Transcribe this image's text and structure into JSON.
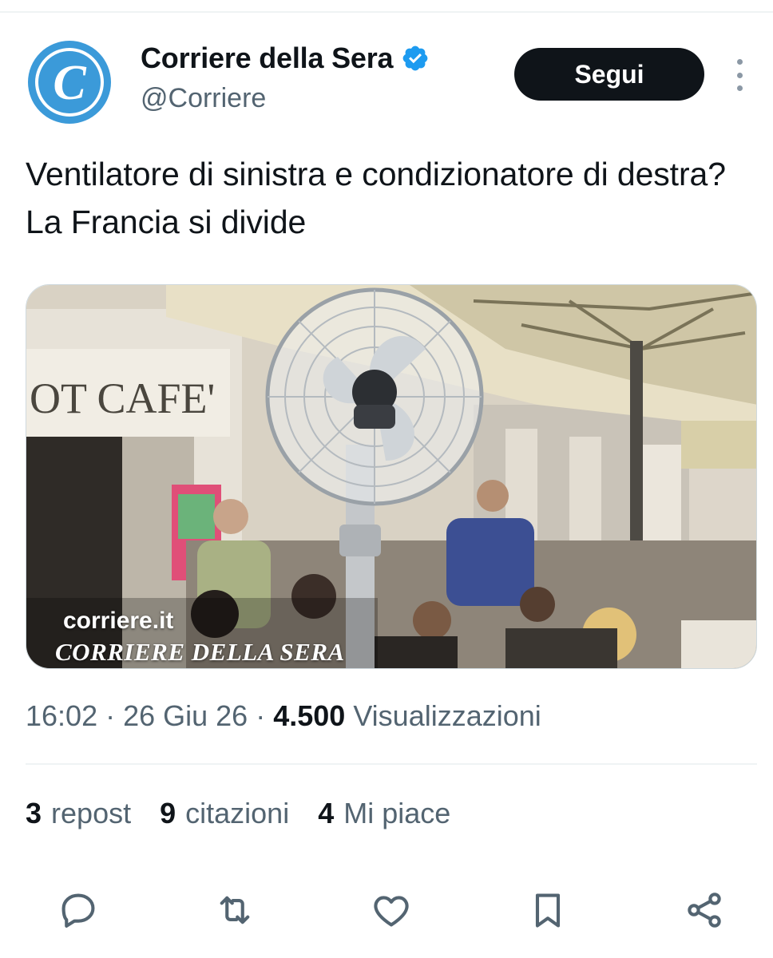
{
  "account": {
    "display_name": "Corriere della Sera",
    "handle": "@Corriere",
    "verified": true,
    "avatar_letter": "C",
    "avatar_color": "#3b9ad9"
  },
  "follow_button": {
    "label": "Segui"
  },
  "tweet": {
    "text": "Ventilatore di sinistra e condizionatore di destra? La Francia si divide"
  },
  "media": {
    "source": "corriere.it",
    "watermark": "CORRIERE DELLA SERA",
    "sign_text": "OT CAFE'"
  },
  "meta": {
    "time": "16:02",
    "separator": "·",
    "date": "26 Giu 26",
    "views_count": "4.500",
    "views_label": "Visualizzazioni"
  },
  "stats": {
    "reposts": {
      "count": "3",
      "label": "repost"
    },
    "quotes": {
      "count": "9",
      "label": "citazioni"
    },
    "likes": {
      "count": "4",
      "label": "Mi piace"
    }
  },
  "actions": [
    {
      "icon": "reply-icon"
    },
    {
      "icon": "repost-icon"
    },
    {
      "icon": "like-icon"
    },
    {
      "icon": "bookmark-icon"
    },
    {
      "icon": "share-icon"
    }
  ],
  "colors": {
    "text_primary": "#0f1419",
    "text_secondary": "#536471",
    "verified_blue": "#1d9bf0",
    "button_dark": "#0f1419"
  }
}
